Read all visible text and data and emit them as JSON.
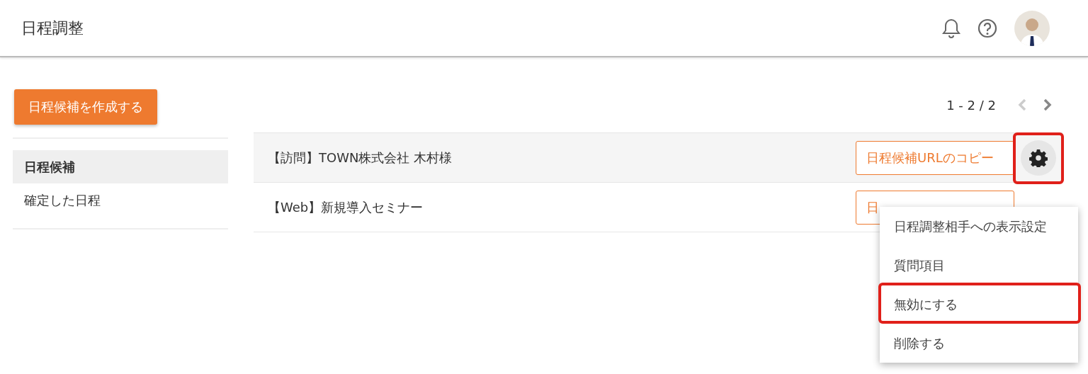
{
  "header": {
    "title": "日程調整"
  },
  "create_button": "日程候補を作成する",
  "sidebar": {
    "items": [
      {
        "label": "日程候補",
        "selected": true
      },
      {
        "label": "確定した日程",
        "selected": false
      }
    ]
  },
  "pagination": {
    "range": "1 - 2 / 2",
    "prev_disabled": true,
    "next_disabled": false
  },
  "rows": [
    {
      "title": "【訪問】TOWN株式会社 木村様",
      "copy_button": "日程候補URLのコピー",
      "hovered": true,
      "gear_visible": true,
      "highlighted": true
    },
    {
      "title": "【Web】新規導入セミナー",
      "copy_button": "日",
      "hovered": false,
      "gear_visible": false,
      "highlighted": false
    }
  ],
  "menu": {
    "items": [
      {
        "label": "日程調整相手への表示設定",
        "highlighted": false
      },
      {
        "label": "質問項目",
        "highlighted": false
      },
      {
        "label": "無効にする",
        "highlighted": true
      },
      {
        "label": "削除する",
        "highlighted": false
      }
    ]
  }
}
